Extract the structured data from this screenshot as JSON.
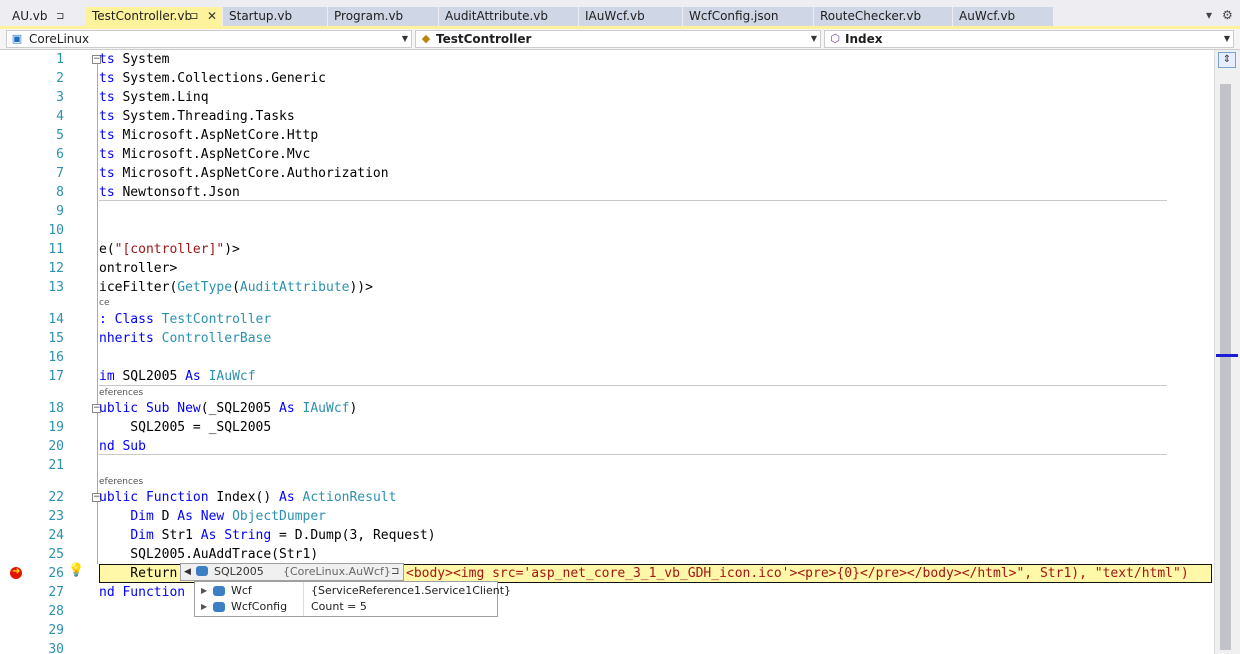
{
  "tabs": [
    {
      "label": "AU.vb",
      "pin": "⊐",
      "active": false
    },
    {
      "label": "TestController.vb",
      "pin": "⊐",
      "close": "✕",
      "active": true
    },
    {
      "label": "Startup.vb",
      "active": false
    },
    {
      "label": "Program.vb",
      "active": false
    },
    {
      "label": "AuditAttribute.vb",
      "active": false
    },
    {
      "label": "IAuWcf.vb",
      "active": false
    },
    {
      "label": "WcfConfig.json",
      "active": false
    },
    {
      "label": "RouteChecker.vb",
      "active": false
    },
    {
      "label": "AuWcf.vb",
      "active": false
    }
  ],
  "tab_overflow_glyph": "▾",
  "settings_glyph": "⚙",
  "navbar": {
    "project": "CoreLinux",
    "class": "TestController",
    "member": "Index"
  },
  "line_numbers": [
    "1",
    "2",
    "3",
    "4",
    "5",
    "6",
    "7",
    "8",
    "9",
    "10",
    "11",
    "12",
    "13",
    "14",
    "15",
    "16",
    "17",
    "18",
    "19",
    "20",
    "21",
    "22",
    "23",
    "24",
    "25",
    "26",
    "27",
    "28",
    "29",
    "30"
  ],
  "code": {
    "l1": {
      "a": "ts",
      "b": " System"
    },
    "l2": {
      "a": "ts",
      "b": " System.Collections.Generic"
    },
    "l3": {
      "a": "ts",
      "b": " System.Linq"
    },
    "l4": {
      "a": "ts",
      "b": " System.Threading.Tasks"
    },
    "l5": {
      "a": "ts",
      "b": " Microsoft.AspNetCore.Http"
    },
    "l6": {
      "a": "ts",
      "b": " Microsoft.AspNetCore.Mvc"
    },
    "l7": {
      "a": "ts",
      "b": " Microsoft.AspNetCore.Authorization"
    },
    "l8": {
      "a": "ts",
      "b": " Newtonsoft.Json"
    },
    "l11": {
      "a": "e(",
      "b": "\"[controller]\"",
      "c": ")>"
    },
    "l12": {
      "a": "ontroller>"
    },
    "l13": {
      "a": "iceFilter(",
      "b": "GetType",
      "c": "(",
      "d": "AuditAttribute",
      "e": "))>"
    },
    "lens13": "ce",
    "l14": {
      "a": ": ",
      "b": "Class",
      "c": " ",
      "d": "TestController"
    },
    "l15": {
      "a": "nherits",
      "b": " ",
      "c": "ControllerBase"
    },
    "l17": {
      "a": "im",
      "b": " SQL2005 ",
      "c": "As",
      "d": " ",
      "e": "IAuWcf"
    },
    "lens18": "eferences",
    "l18": {
      "a": "ublic Sub New",
      "b": "(_SQL2005 ",
      "c": "As",
      "d": " ",
      "e": "IAuWcf",
      "f": ")"
    },
    "l19": {
      "a": "    SQL2005 = _SQL2005"
    },
    "l20": {
      "a": "nd Sub"
    },
    "lens22": "eferences",
    "l22": {
      "a": "ublic Function",
      "b": " Index() ",
      "c": "As",
      "d": " ",
      "e": "ActionResult"
    },
    "l23": {
      "a": "    ",
      "b": "Dim",
      "c": " D ",
      "d": "As New",
      "e": " ",
      "f": "ObjectDumper"
    },
    "l24": {
      "a": "    ",
      "b": "Dim",
      "c": " Str1 ",
      "d": "As String",
      "e": " = D.Dump(3, Request)"
    },
    "l25": {
      "a": "    SQL2005.AuAddTrace(Str1)"
    },
    "l26": {
      "a": "    Return",
      "b": "<body><img src='asp_net_core_3_1_vb_GDH_icon.ico'><pre>{0}</pre></body></html>\", Str1), \"text/html\")"
    },
    "l27": {
      "a": "nd Function"
    }
  },
  "datatip": {
    "name": "SQL2005",
    "type": "{CoreLinux.AuWcf}",
    "pin_glyph": "⊐",
    "rows": [
      {
        "name": "Wcf",
        "value": "{ServiceReference1.Service1Client}"
      },
      {
        "name": "WcfConfig",
        "value": "Count = 5"
      }
    ]
  },
  "colors": {
    "active_tab": "#fff29d",
    "keyword": "#0000ff",
    "type": "#2b91af",
    "string": "#a31515",
    "line_number": "#2b91af",
    "current_statement": "#fff8a8"
  }
}
